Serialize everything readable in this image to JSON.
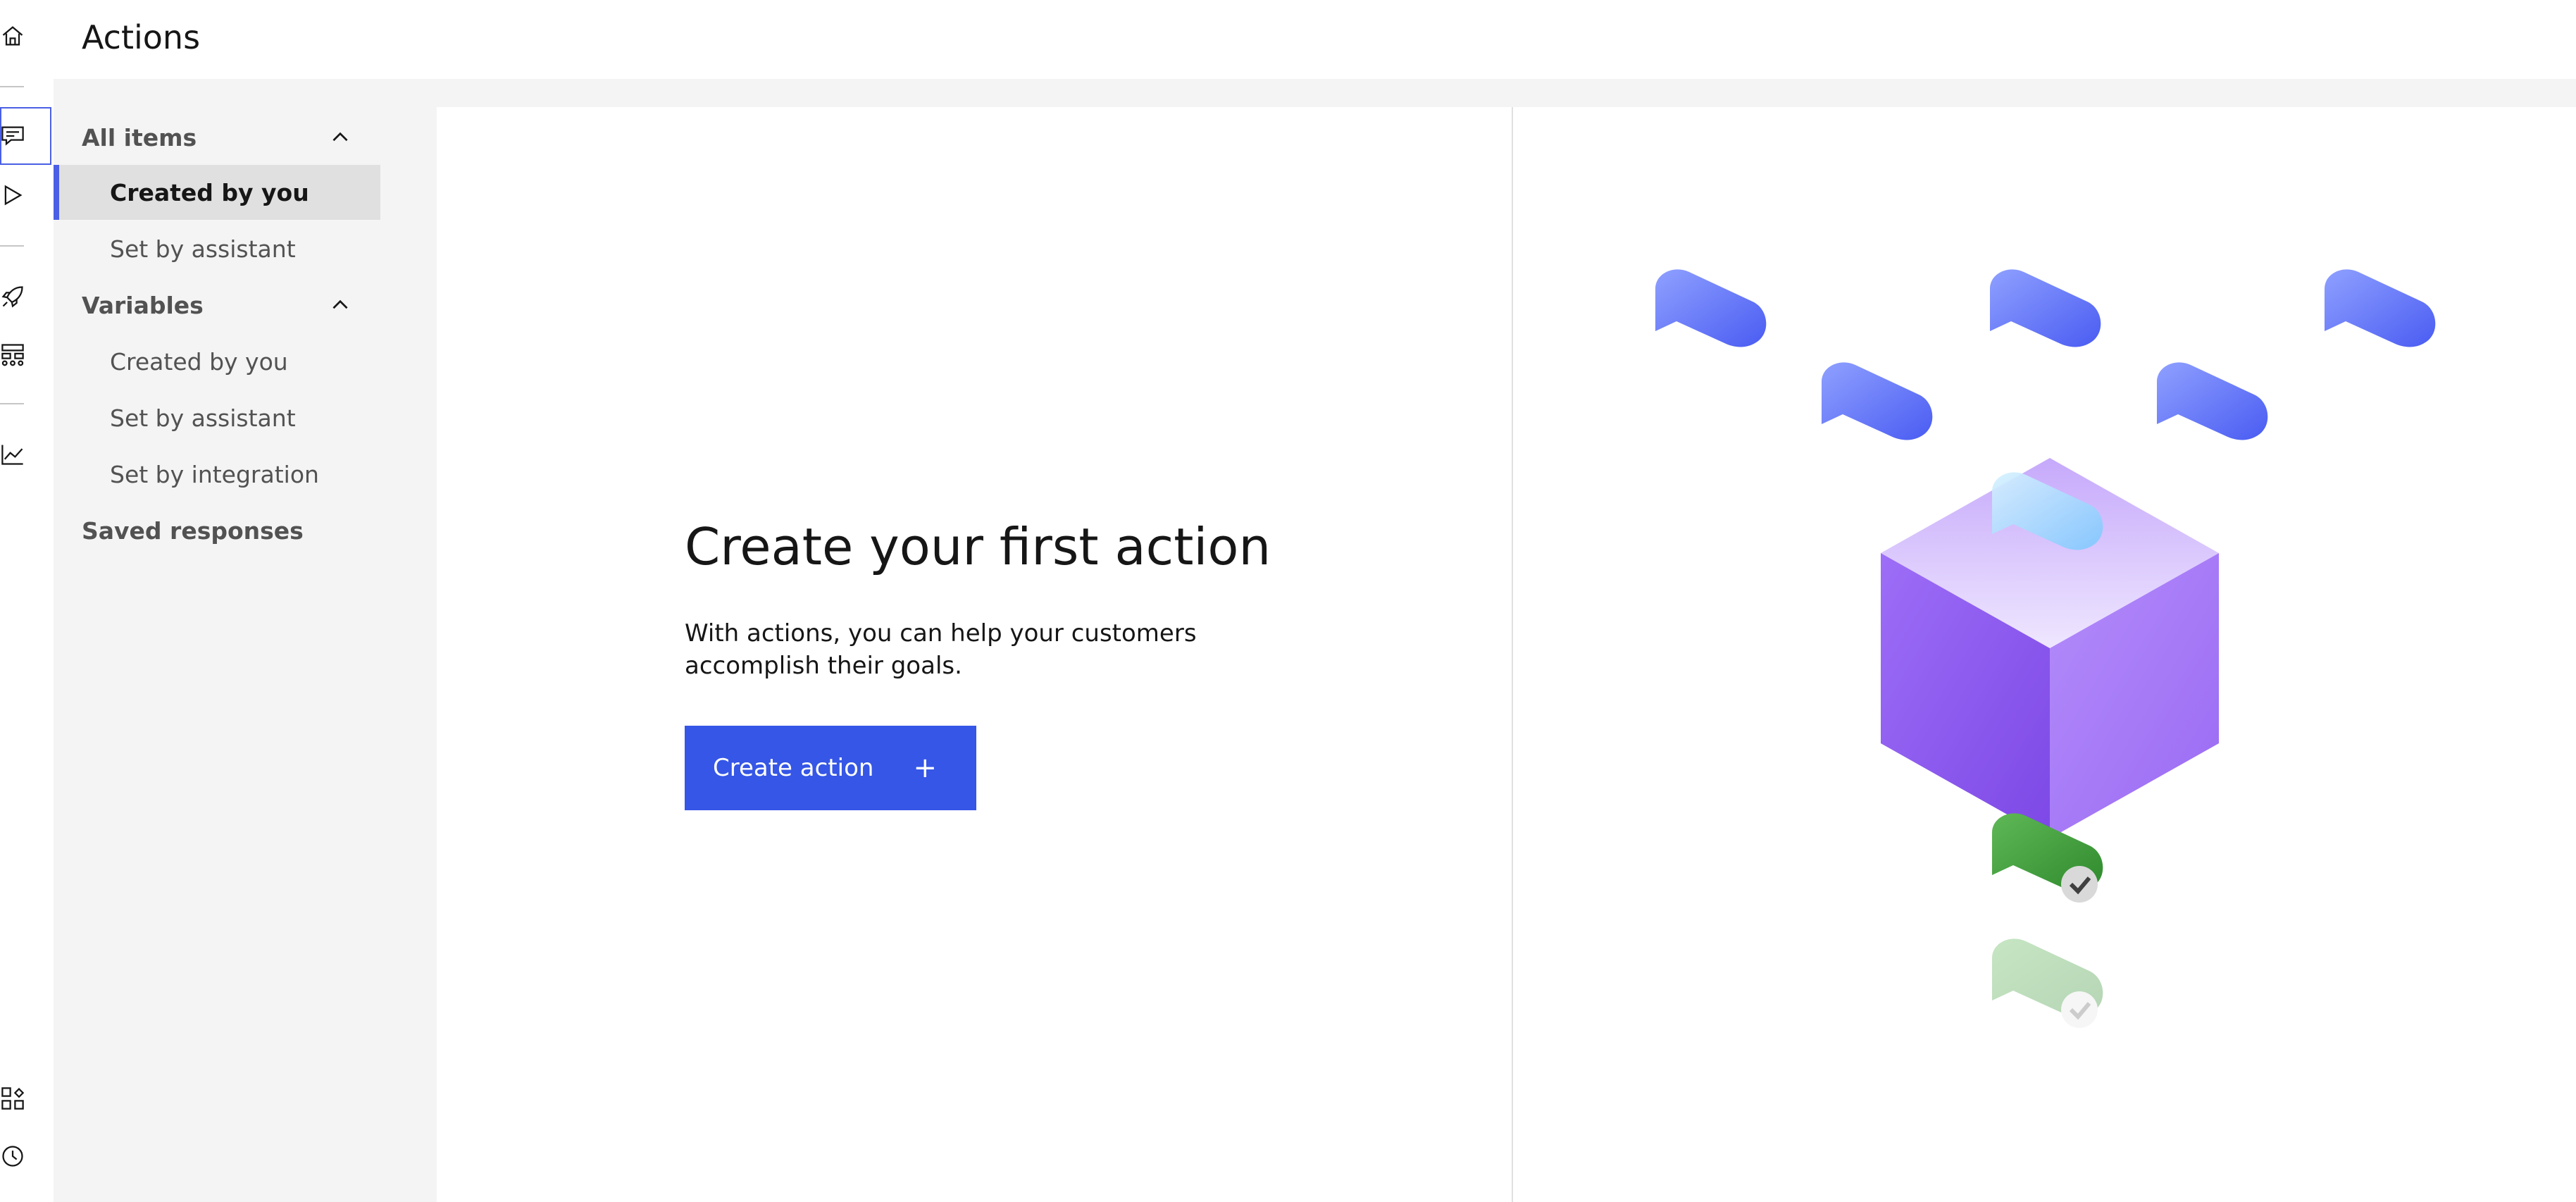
{
  "header": {
    "title": "Actions"
  },
  "rail": {
    "icons": [
      "home-icon",
      "chat-icon",
      "play-icon",
      "rocket-icon",
      "tree-icon",
      "chart-icon",
      "integrations-icon",
      "history-icon"
    ],
    "active": "chat-icon"
  },
  "subnav": {
    "sections": [
      {
        "label": "All items",
        "expanded": true,
        "items": [
          {
            "label": "Created by you",
            "selected": true
          },
          {
            "label": "Set by assistant",
            "selected": false
          }
        ]
      },
      {
        "label": "Variables",
        "expanded": true,
        "items": [
          {
            "label": "Created by you",
            "selected": false
          },
          {
            "label": "Set by assistant",
            "selected": false
          },
          {
            "label": "Set by integration",
            "selected": false
          }
        ]
      },
      {
        "label": "Saved responses"
      }
    ]
  },
  "main": {
    "title": "Create your first action",
    "description": "With actions, you can help your customers accomplish their goals.",
    "button_label": "Create action",
    "button_icon": "plus-icon"
  },
  "colors": {
    "accent": "#3556e6",
    "nav_bg": "#f4f4f4",
    "cube": "#9b6bf3",
    "bubble": "#4f63f0",
    "success": "#3f9a3a"
  }
}
